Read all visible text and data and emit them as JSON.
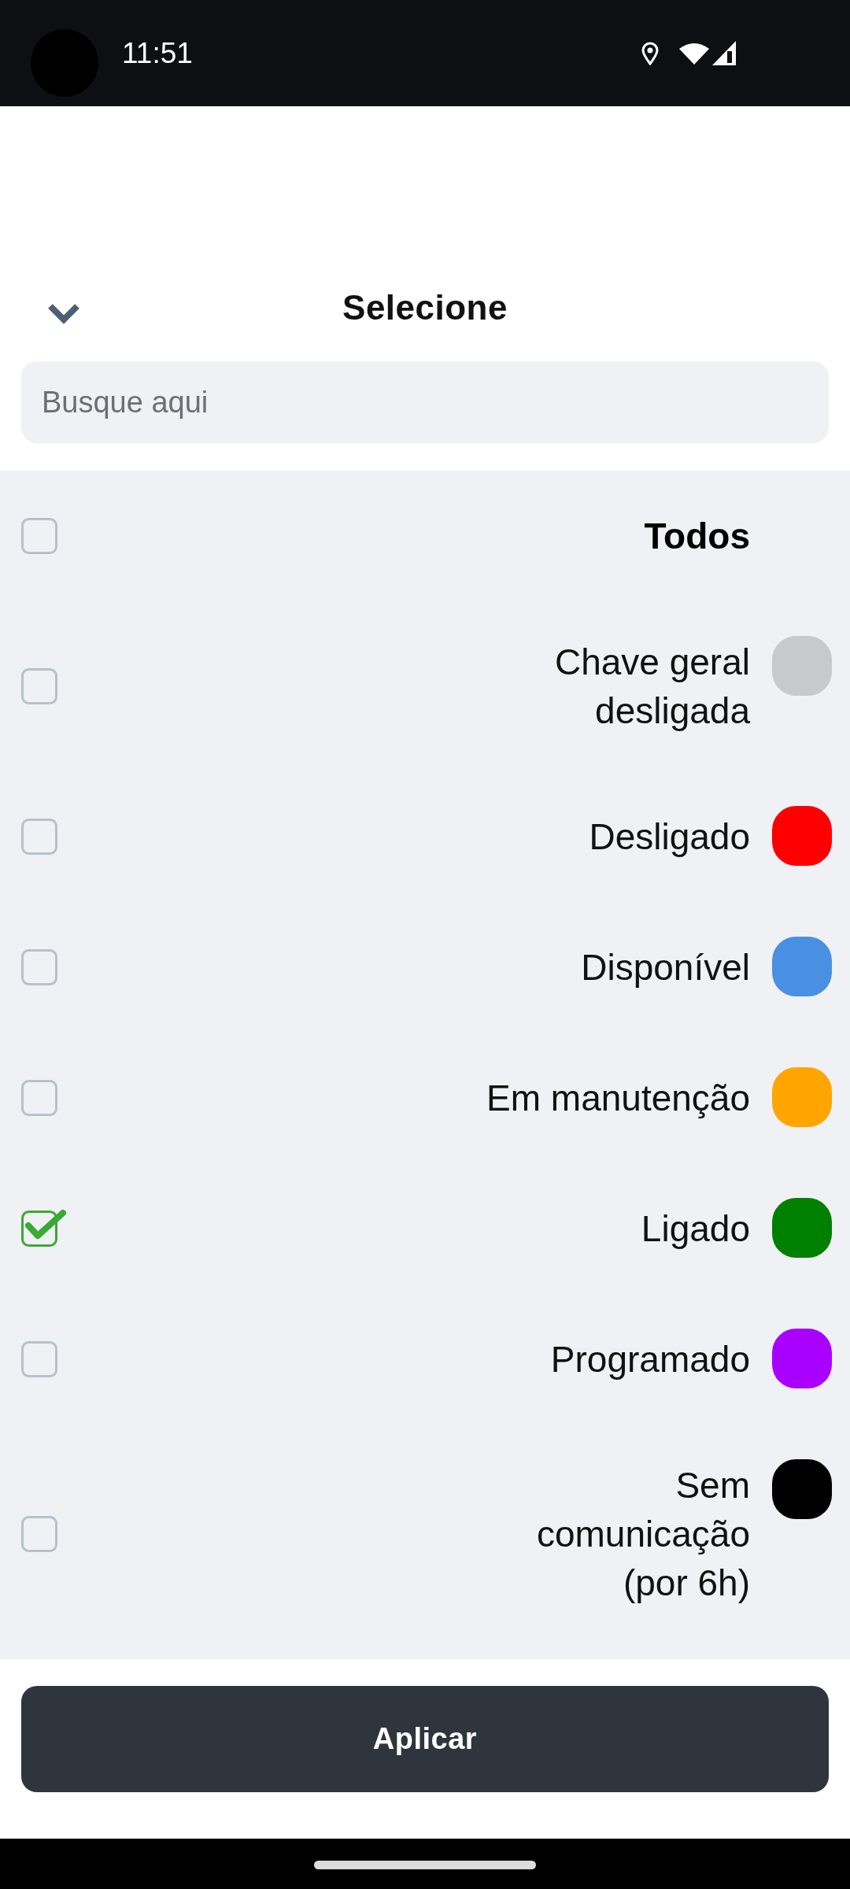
{
  "status_bar": {
    "time": "11:51"
  },
  "sheet": {
    "title": "Selecione",
    "search": {
      "placeholder": "Busque aqui"
    },
    "select_all": {
      "label": "Todos",
      "checked": false
    },
    "options": [
      {
        "label": "Chave geral desligada",
        "checked": false,
        "color": "#c8c9cd"
      },
      {
        "label": "Desligado",
        "checked": false,
        "color": "#ff0000"
      },
      {
        "label": "Disponível",
        "checked": false,
        "color": "#4a90e2"
      },
      {
        "label": "Em manutenção",
        "checked": false,
        "color": "#ffa500"
      },
      {
        "label": "Ligado",
        "checked": true,
        "color": "#008000"
      },
      {
        "label": "Programado",
        "checked": false,
        "color": "#aa00ff"
      },
      {
        "label": "Sem comunicação (por 6h)",
        "checked": false,
        "color": "#000000"
      }
    ],
    "apply_button": {
      "label": "Aplicar"
    }
  }
}
